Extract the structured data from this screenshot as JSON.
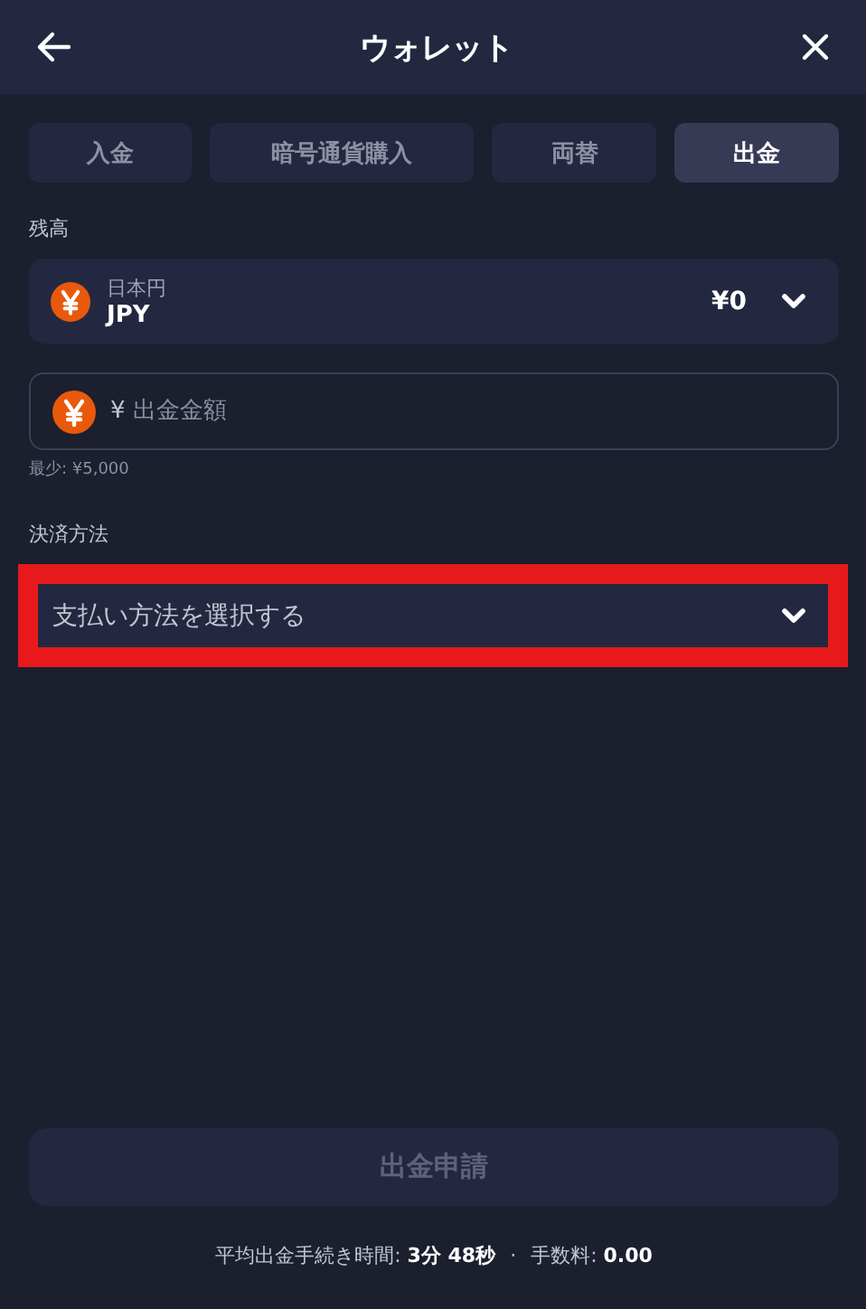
{
  "window": {
    "title": "ウォレット"
  },
  "tabs": [
    {
      "label": "入金",
      "selected": false
    },
    {
      "label": "暗号通貨購入",
      "selected": false
    },
    {
      "label": "両替",
      "selected": false
    },
    {
      "label": "出金",
      "selected": true
    }
  ],
  "balance": {
    "label": "残高",
    "currency_name": "日本円",
    "currency_code": "JPY",
    "amount": "¥0"
  },
  "amount_field": {
    "prefix": "¥",
    "placeholder": "出金金額",
    "hint": "最少: ¥5,000"
  },
  "payment_method": {
    "label": "決済方法",
    "placeholder": "支払い方法を選択する",
    "highlighted": true
  },
  "submit": {
    "label": "出金申請",
    "disabled": true
  },
  "footer": [
    {
      "text": "平均出金手続き時間: **3分 48秒**"
    },
    {
      "text": "手数料: **0.00**"
    }
  ],
  "footer_separator": "·"
}
